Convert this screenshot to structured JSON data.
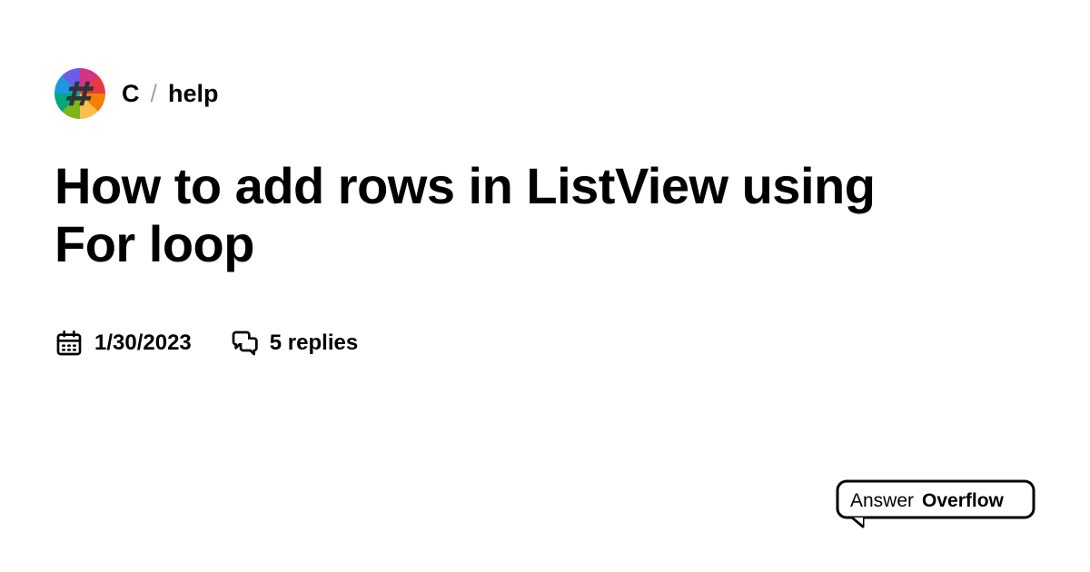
{
  "breadcrumb": {
    "category": "C",
    "separator": "/",
    "channel": "help"
  },
  "title": "How to add rows in ListView using For loop",
  "meta": {
    "date": "1/30/2023",
    "replies": "5 replies"
  },
  "logo": {
    "text1": "Answer",
    "text2": "Overflow"
  }
}
